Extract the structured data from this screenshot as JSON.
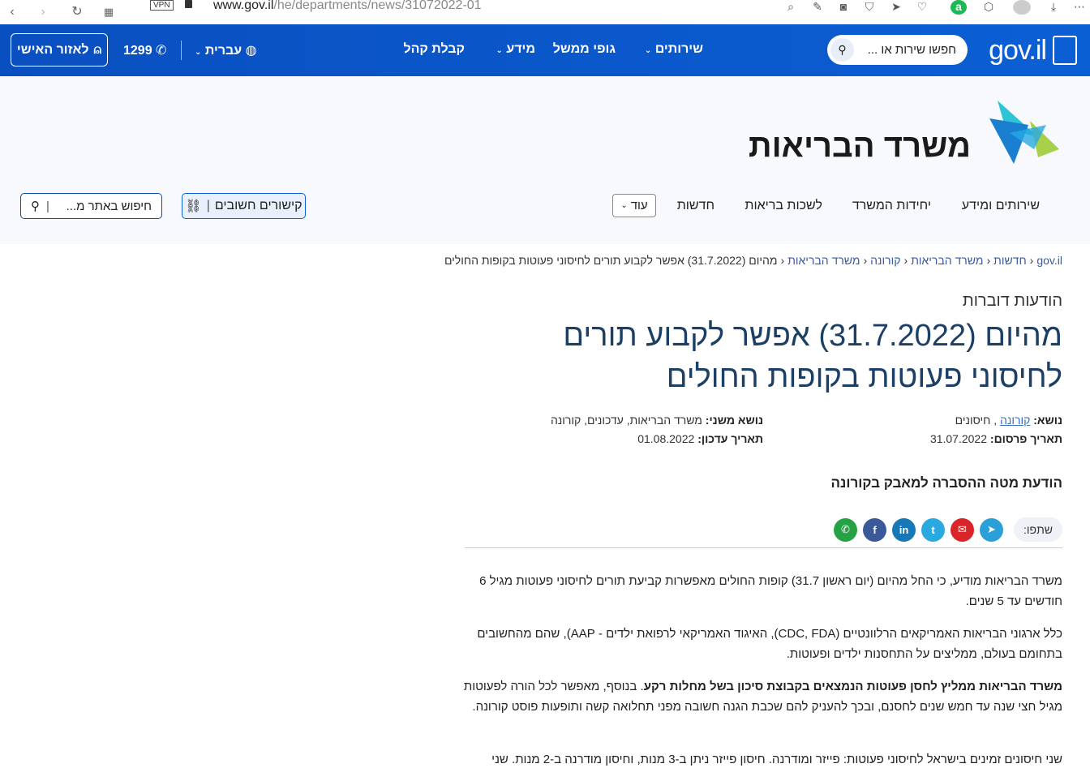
{
  "browser": {
    "url_host": "www.gov.il",
    "url_path": "/he/departments/news/31072022-01",
    "vpn_label": "VPN"
  },
  "gov_header": {
    "logo_text": "gov.il",
    "search_placeholder": "חפשו שירות או ...",
    "menu": [
      "שירותים",
      "גופי ממשל",
      "מידע",
      "קבלת קהל"
    ],
    "language": "עברית",
    "phone": "1299",
    "personal_area": "לאזור האישי"
  },
  "ministry": {
    "title": "משרד הבריאות",
    "nav": [
      "שירותים ומידע",
      "יחידות המשרד",
      "לשכות בריאות",
      "חדשות"
    ],
    "more_label": "עוד",
    "links_label": "קישורים חשובים",
    "site_search_placeholder": "חיפוש באתר מ..."
  },
  "breadcrumb": [
    "gov.il",
    "חדשות",
    "משרד הבריאות",
    "קורונה",
    "משרד הבריאות",
    "מהיום (31.7.2022) אפשר לקבוע תורים לחיסוני פעוטות בקופות החולים"
  ],
  "article": {
    "kicker": "הודעות דוברות",
    "headline": "מהיום (31.7.2022) אפשר לקבוע תורים לחיסוני פעוטות בקופות החולים",
    "topic_label": "נושא:",
    "topic_link": "קורונה",
    "topic_rest": " , חיסונים",
    "subtopic_label": "נושא משני:",
    "subtopic_value": " משרד הבריאות, עדכונים, קורונה",
    "published_label": "תאריך פרסום:",
    "published_value": " 31.07.2022",
    "updated_label": "תאריך עדכון:",
    "updated_value": " 01.08.2022",
    "subhead": "הודעת מטה ההסברה למאבק בקורונה",
    "share_label": "שתפו:",
    "paragraphs": [
      "משרד הבריאות מודיע, כי החל מהיום (יום ראשון 31.7) קופות החולים מאפשרות קביעת תורים לחיסוני פעוטות מגיל 6 חודשים עד 5 שנים.",
      "כלל ארגוני הבריאות האמריקאים הרלוונטיים (CDC, FDA), האיגוד האמריקאי לרפואת ילדים - AAP), שהם מהחשובים בתחומם בעולם, ממליצים על התחסנות ילדים ופעוטות."
    ],
    "para3_bold": "משרד הבריאות ממליץ לחסן פעוטות הנמצאים בקבוצת סיכון בשל מחלות רקע",
    "para3_rest": ". בנוסף, מאפשר לכל הורה לפעוטות מגיל חצי שנה עד חמש שנים לחסנם, ובכך להעניק להם שכבת הגנה חשובה מפני תחלואה קשה ותופעות פוסט קורונה.",
    "para4": "שני חיסונים זמינים בישראל לחיסוני פעוטות: פייזר ומודרנה. חיסון פייזר ניתן ב-3 מנות, וחיסון מודרנה ב-2 מנות. שני"
  },
  "colors": {
    "gov_blue": "#0b5fd4",
    "headline": "#1c3f66",
    "whatsapp": "#25a244",
    "facebook": "#3b5998",
    "linkedin": "#1877b5",
    "twitter": "#2aa9e0",
    "email": "#d9252a",
    "telegram": "#2a9fd8"
  }
}
